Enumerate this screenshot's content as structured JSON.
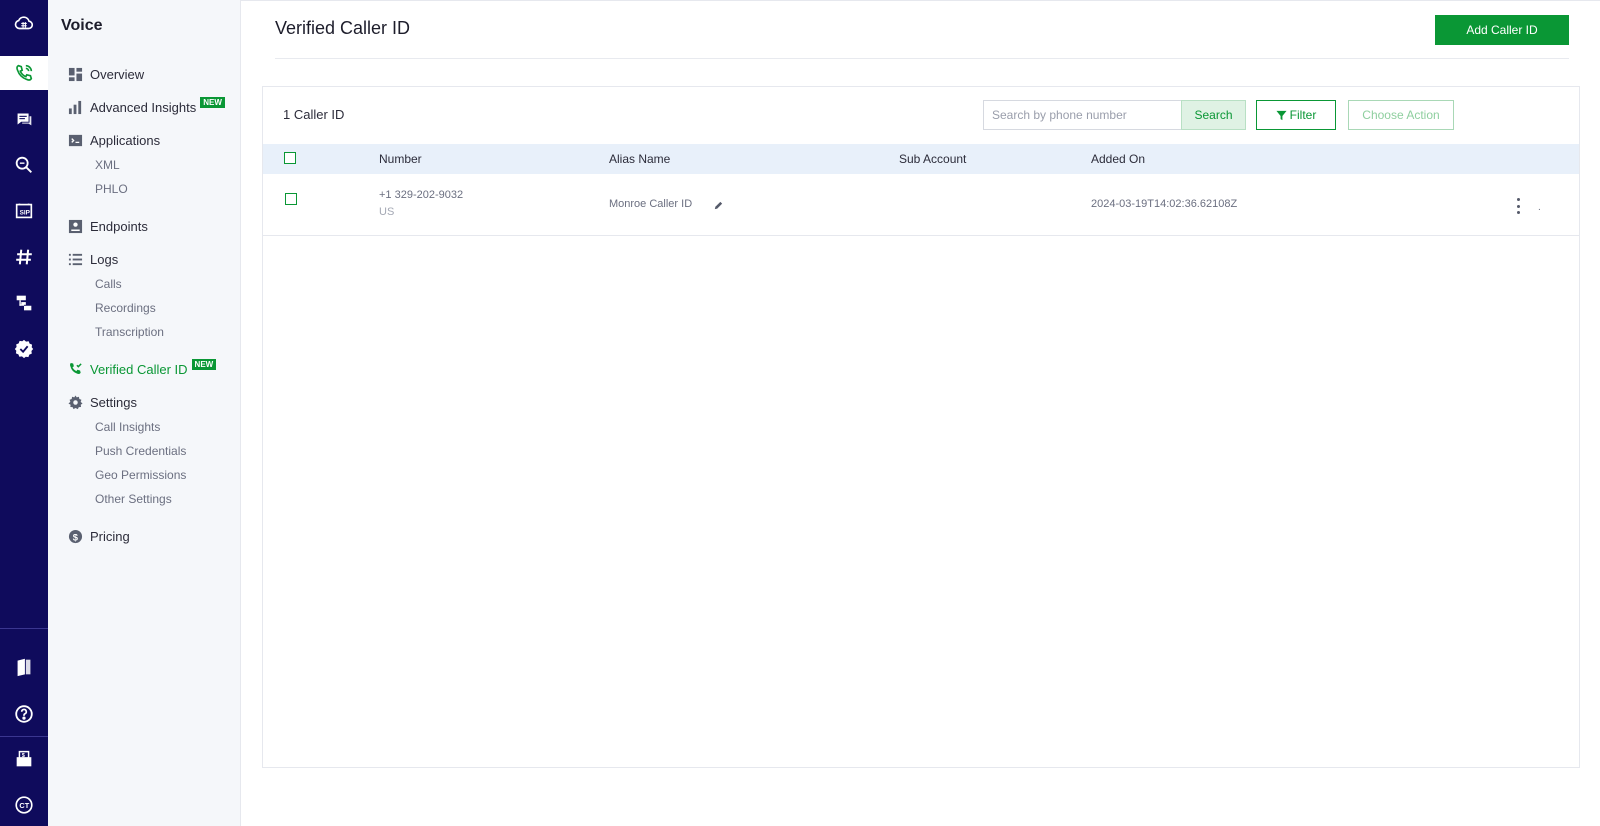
{
  "sidebar": {
    "title": "Voice",
    "items": [
      {
        "label": "Overview"
      },
      {
        "label": "Advanced Insights",
        "badge": "NEW"
      },
      {
        "label": "Applications",
        "sub": [
          "XML",
          "PHLO"
        ]
      },
      {
        "label": "Endpoints"
      },
      {
        "label": "Logs",
        "sub": [
          "Calls",
          "Recordings",
          "Transcription"
        ]
      },
      {
        "label": "Verified Caller ID",
        "badge": "NEW",
        "active": true
      },
      {
        "label": "Settings",
        "sub": [
          "Call Insights",
          "Push Credentials",
          "Geo Permissions",
          "Other Settings"
        ]
      },
      {
        "label": "Pricing"
      }
    ]
  },
  "rail": {
    "icons": [
      "cloud-logo-icon",
      "voice-icon",
      "messaging-icon",
      "lookup-icon",
      "sip-icon",
      "hashtag-icon",
      "flow-icon",
      "verify-badge-icon",
      "docs-icon",
      "help-icon",
      "billing-icon",
      "account-icon"
    ]
  },
  "header": {
    "title": "Verified Caller ID",
    "add_button": "Add Caller ID"
  },
  "toolbar": {
    "count_label": "1 Caller ID",
    "search_placeholder": "Search by phone number",
    "search_button": "Search",
    "filter_button": "Filter",
    "action_button": "Choose Action"
  },
  "table": {
    "columns": [
      "Number",
      "Alias Name",
      "Sub Account",
      "Added On"
    ],
    "rows": [
      {
        "number": "+1 329-202-9032",
        "country": "US",
        "alias": "Monroe Caller ID",
        "sub_account": "",
        "added_on": "2024-03-19T14:02:36.62108Z",
        "trailing": "."
      }
    ]
  },
  "colors": {
    "accent": "#0a9735",
    "rail": "#0f0b5c",
    "header_row": "#e8f0fa"
  }
}
